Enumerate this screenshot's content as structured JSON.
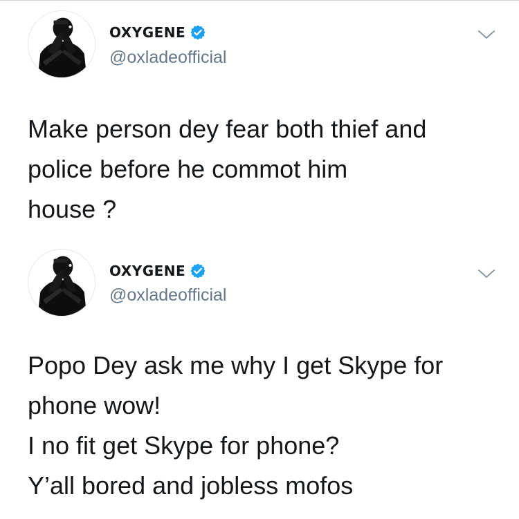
{
  "colors": {
    "text": "#14171a",
    "secondary": "#657786",
    "verified": "#1da1f2"
  },
  "tweets": [
    {
      "author": {
        "display_name": "OXYGENE",
        "handle": "@oxladeofficial",
        "verified": true,
        "avatar_icon": "avatar-photo"
      },
      "menu_icon": "chevron-down-icon",
      "text_lines": [
        "Make person dey fear both thief and",
        "police before he commot him",
        "house ?"
      ]
    },
    {
      "author": {
        "display_name": "OXYGENE",
        "handle": "@oxladeofficial",
        "verified": true,
        "avatar_icon": "avatar-photo"
      },
      "menu_icon": "chevron-down-icon",
      "text_lines": [
        "Popo Dey ask me why I get Skype for",
        "phone wow!",
        "I no fit get Skype for phone?",
        "Y’all bored and jobless mofos"
      ]
    }
  ]
}
